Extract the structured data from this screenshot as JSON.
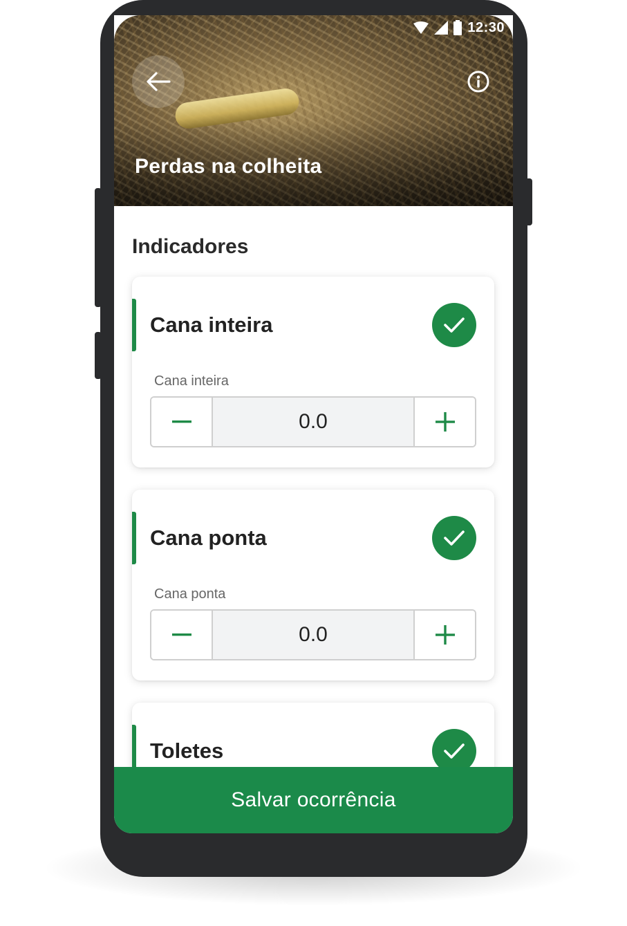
{
  "status_bar": {
    "time": "12:30"
  },
  "header": {
    "title": "Perdas na colheita",
    "back_icon": "arrow-left-icon",
    "info_icon": "info-icon"
  },
  "section": {
    "title": "Indicadores"
  },
  "cards": [
    {
      "title": "Cana inteira",
      "field_label": "Cana inteira",
      "value": "0.0",
      "checked": true
    },
    {
      "title": "Cana ponta",
      "field_label": "Cana ponta",
      "value": "0.0",
      "checked": true
    },
    {
      "title": "Toletes",
      "checked": true
    }
  ],
  "stepper_icons": {
    "decrement": "minus-icon",
    "increment": "plus-icon"
  },
  "footer": {
    "save_label": "Salvar ocorrência"
  },
  "colors": {
    "accent": "#1e8a47",
    "save_bar": "#1b8a4a",
    "phone_frame": "#2a2b2d"
  }
}
